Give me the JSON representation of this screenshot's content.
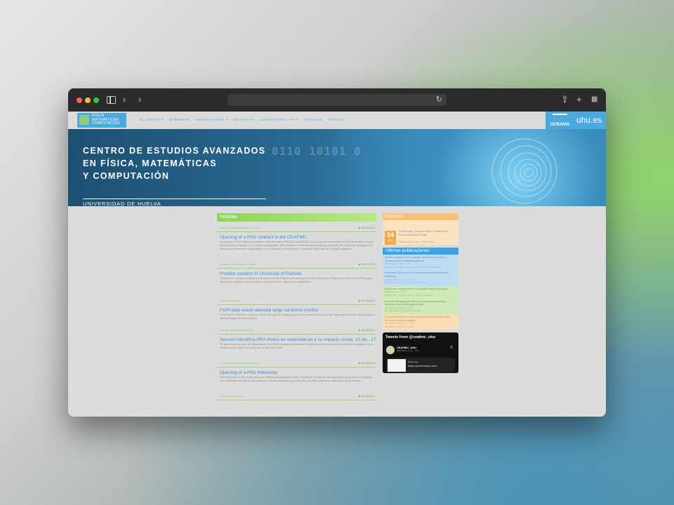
{
  "browser": {
    "url": "",
    "icons": {
      "back": "chevron-left-icon",
      "forward": "chevron-right-icon",
      "reload": "reload-icon",
      "share": "share-icon",
      "new_tab": "plus-icon",
      "tabs": "tab-overview-icon"
    }
  },
  "site": {
    "logo_lines": [
      "FÍSICA",
      "MATEMÁTICAS",
      "COMPUTACIÓN"
    ],
    "nav": [
      "EL CENTRO ▾",
      "MIEMBROS",
      "INVESTIGACIÓN ▾",
      "NOTICIAS ▾",
      "LABORATORIO LIFE ▾",
      "OFICINAS",
      "OFFICES"
    ],
    "ucrania_label": "UCRANIA",
    "uhu_label": "uhu.es"
  },
  "banner": {
    "title_lines": [
      "CENTRO DE ESTUDIOS AVANZADOS",
      "EN FÍSICA, MATEMÁTICAS",
      "Y COMPUTACIÓN"
    ],
    "subtitle": "UNIVERSIDAD DE HUELVA",
    "binary": "0110 10101 0"
  },
  "noticias": {
    "heading": "Noticias",
    "items": [
      {
        "author": "Fuente: Universidad de Huelva",
        "date": "30/10/2023",
        "title": "Opening of a PhD contract in the CEAFMC",
        "excerpt": "Opening of a PhD contract associated with the project PID2022-136829NB-C22 to work on the formation of the structures in which fluid viscosity is studied in a complex configuration with relevance to industrial and natural processes, the multiscale transport and turbulence phenomena. Applications of the research include topics in nonlinear dynamics and complex systems..."
      },
      {
        "author": "Fuente: University of Padova",
        "date": "30/10/2023",
        "title": "Postdoc position in University of Padova",
        "excerpt": "Opening of a postdoc position in the department of Physics and Astronomy at the University of Padova to work on the ERC project. Application deadline and more information at the link: https://www.unipd.it/en/..."
      },
      {
        "author": "Fuente: Science",
        "date": "30/10/2023",
        "title": "FAIR data would alleviate large carnivore conflict",
        "excerpt": "Comment in CEAFMC members Javier Fabrega and collaborators in the journal Science, on the importance of FAIR data policies to alleviate large carnivore conflict."
      },
      {
        "author": "Fuente: Fundación Andaluz",
        "date": "30/10/2023",
        "title": "Sección identifica PRA-Retos en matemáticas y su impacto social, 12 dic., 17h",
        "excerpt": "Se presenta la sección de matemáticas de la Real Sociedad Matemática Española en el marco de la iniciativa de divulgación y su impacto social. Más información en la web del centro."
      },
      {
        "author": "Fuente: Universidad de Huelva",
        "date": "30/10/2023",
        "title": "Opening of a PhD fellowship",
        "excerpt": "PhD fellowship in the project Study of switching and dynamic phase transitions in systems with application to quantum computing. The candidate will work on the analysis of phase transitions and criticality. Deadline and more information at the website."
      },
      {
        "author": "Fuente: Huelva Info",
        "date": "30/10/2023",
        "title": "",
        "excerpt": ""
      }
    ]
  },
  "eventos": {
    "heading": "Eventos",
    "items": [
      {
        "day": "24",
        "month": "NOV",
        "title": "Conferencia: Quantum Phase Transitions in Superconducting Circuits",
        "meta": "Edificio Marie Curie · 12:00 horas"
      }
    ]
  },
  "publicaciones": {
    "heading": "Últimas publicaciones",
    "items": [
      {
        "style": "blue",
        "title": "Spectral analysis of the singular value decomposition in complex driven dynamical systems",
        "authors": "■ Ecology Letters, 2023",
        "detail": "■ Pérez-Moreno, Sánchez-Gómez, Herrera Aldana"
      },
      {
        "style": "blue",
        "title": "Stochastic SEIR model for inferring epidemic dynamics in Andalucía",
        "authors": "■ Physical Review E, 2023",
        "detail": "■ Gómez-Martín, Rodríguez, Martínez"
      },
      {
        "style": "green",
        "title": "Plasmonic nanostructures for enhanced light harvesting",
        "authors": "■ Nanoscale, 2023",
        "detail": "■ Ramírez, López-García, Torres, Navarro"
      },
      {
        "style": "green",
        "title": "Machine learning approaches to predict protein folding dynamics from coarse-grained data",
        "authors": "■ Physical Biology, 2023",
        "detail": "■ Díaz, Moreno, Castillo, Ortega"
      },
      {
        "style": "orange",
        "title": "Quantum transport in hybrid superconducting devices and correlated electron systems",
        "authors": "■ Physical Review B, 2023",
        "detail": "■ Vázquez, Herrera, Luna"
      }
    ]
  },
  "twitter": {
    "heading": "Tweets from @ceafmc_uhu",
    "name": "CEAFMC_UHU",
    "handle": "@ceafmc_uhu · 24h",
    "card_domain": "phys.org",
    "card_snippet": "Mass spectrometry sorts"
  }
}
